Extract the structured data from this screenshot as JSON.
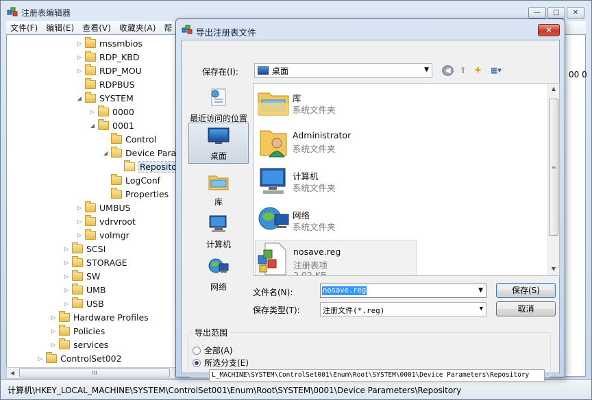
{
  "main_window": {
    "title": "注册表编辑器",
    "window_buttons": [
      "—",
      "□",
      "✕"
    ],
    "menu": [
      "文件(F)",
      "编辑(E)",
      "查看(V)",
      "收藏夹(A)",
      "帮"
    ],
    "tree": [
      {
        "label": "mssmbios",
        "arrow": "▷"
      },
      {
        "label": "RDP_KBD",
        "arrow": "▷"
      },
      {
        "label": "RDP_MOU",
        "arrow": "▷"
      },
      {
        "label": "RDPBUS",
        "arrow": ""
      },
      {
        "label": "SYSTEM",
        "arrow": "◢"
      },
      {
        "label": "0000",
        "arrow": "▷"
      },
      {
        "label": "0001",
        "arrow": "◢"
      },
      {
        "label": "Control",
        "arrow": ""
      },
      {
        "label": "Device Paran",
        "arrow": "◢"
      },
      {
        "label": "Repositor",
        "arrow": ""
      },
      {
        "label": "LogConf",
        "arrow": ""
      },
      {
        "label": "Properties",
        "arrow": ""
      },
      {
        "label": "UMBUS",
        "arrow": "▷"
      },
      {
        "label": "vdrvroot",
        "arrow": "▷"
      },
      {
        "label": "volmgr",
        "arrow": "▷"
      },
      {
        "label": "SCSI",
        "arrow": "▷"
      },
      {
        "label": "STORAGE",
        "arrow": "▷"
      },
      {
        "label": "SW",
        "arrow": "▷"
      },
      {
        "label": "UMB",
        "arrow": "▷"
      },
      {
        "label": "USB",
        "arrow": "▷"
      },
      {
        "label": "Hardware Profiles",
        "arrow": "▷"
      },
      {
        "label": "Policies",
        "arrow": "▷"
      },
      {
        "label": "services",
        "arrow": "▷"
      },
      {
        "label": "ControlSet002",
        "arrow": "▷"
      }
    ],
    "hscroll_grip": "III",
    "right_pane_value": "00 0",
    "status_path": "计算机\\HKEY_LOCAL_MACHINE\\SYSTEM\\ControlSet001\\Enum\\Root\\SYSTEM\\0001\\Device Parameters\\Repository"
  },
  "dialog": {
    "title": "导出注册表文件",
    "close": "✕",
    "save_in_label": "保存在(I):",
    "save_in_value": "桌面",
    "places": [
      "最近访问的位置",
      "桌面",
      "库",
      "计算机",
      "网络"
    ],
    "files": [
      {
        "name": "库",
        "type": "系统文件夹"
      },
      {
        "name": "Administrator",
        "type": "系统文件夹"
      },
      {
        "name": "计算机",
        "type": "系统文件夹"
      },
      {
        "name": "网络",
        "type": "系统文件夹"
      },
      {
        "name": "nosave.reg",
        "type": "注册表项",
        "size": "2.02 KB"
      }
    ],
    "filename_label": "文件名(N):",
    "filename_value": "nosave.reg",
    "filetype_label": "保存类型(T):",
    "filetype_value": "注册文件(*.reg)",
    "save_button": "保存(S)",
    "cancel_button": "取消",
    "range_title": "导出范围",
    "range_all": "全部(A)",
    "range_selected": "所选分支(E)",
    "selected_branch": "L_MACHINE\\SYSTEM\\ControlSet001\\Enum\\Root\\SYSTEM\\0001\\Device Parameters\\Repository"
  }
}
